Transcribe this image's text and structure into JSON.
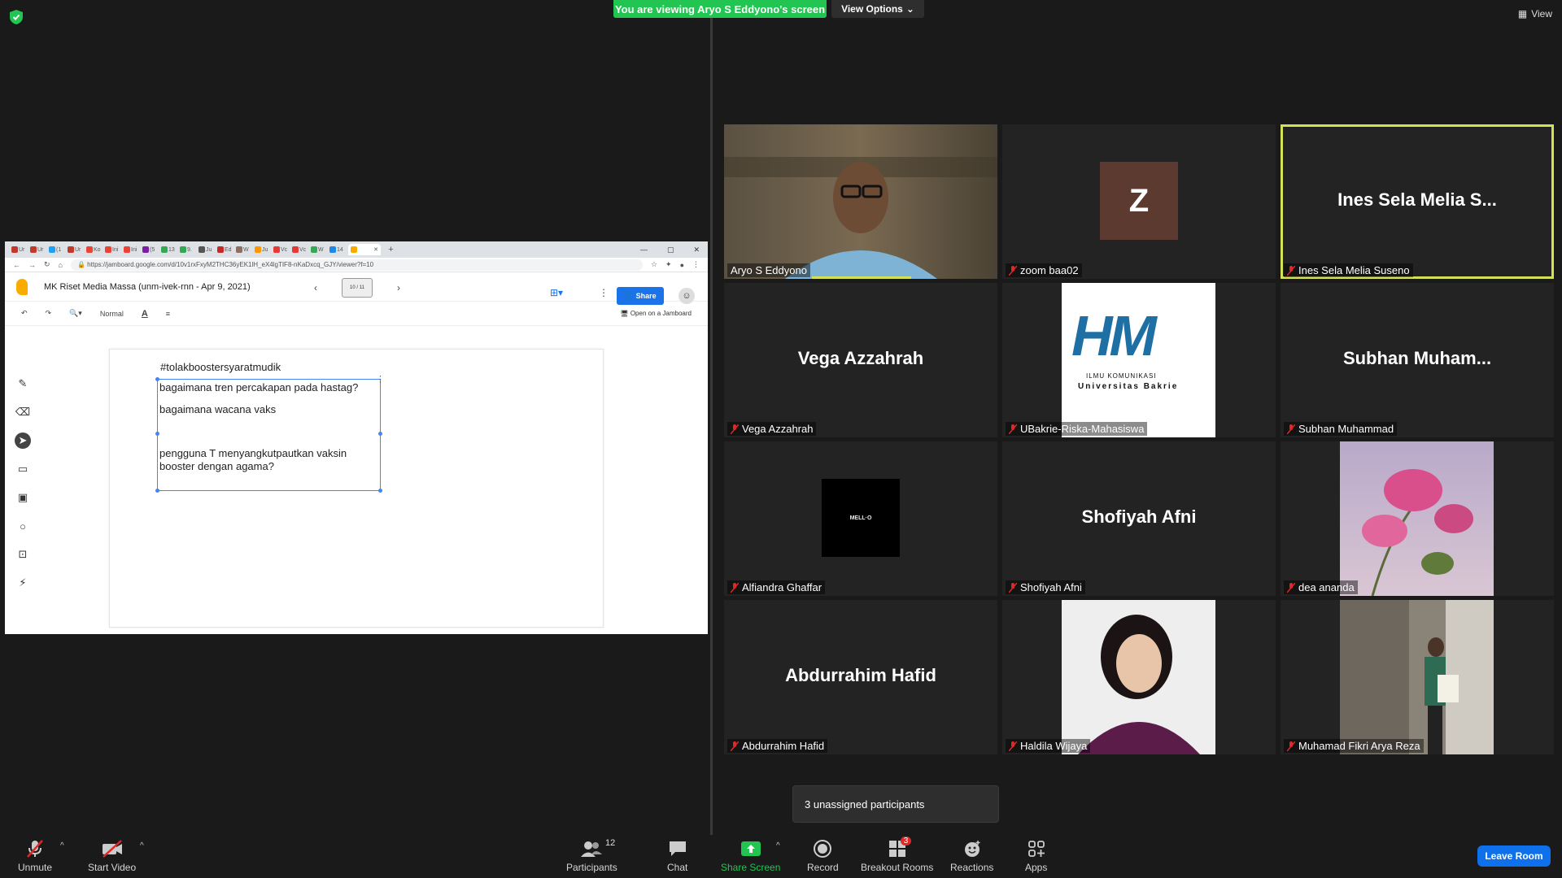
{
  "banner": {
    "viewing": "You are viewing Aryo S Eddyono's screen",
    "view_options": "View Options",
    "view": "View"
  },
  "shared_screen": {
    "tabs": [
      "Ur",
      "Ur",
      "(1",
      "Ur",
      "Ko",
      "Ini",
      "Ini",
      "(5",
      "13",
      "9.",
      "Ju",
      "Ed",
      "W",
      "Ju",
      "Vc",
      "Vc",
      "W",
      "14"
    ],
    "url": "https://jamboard.google.com/d/10v1rxFxyM2THC36yEK1lH_eX4lgTIF8-nKaDxcq_GJY/viewer?f=10",
    "doc_title": "MK Riset Media Massa (unm-ivek-rnn - Apr 9, 2021)",
    "frame_counter": "10 / 11",
    "share_label": "Share",
    "zoom_level": "Normal",
    "open_on_jamboard": "Open on a Jamboard",
    "hashtag": "#tolakboostersyaratmudik",
    "line1": "bagaimana tren percakapan pada hastag?",
    "line2": "bagaimana wacana vaks",
    "line3": "pengguna T menyangkutpautkan vaksin booster dengan agama?"
  },
  "participants": [
    {
      "name": "Aryo S Eddyono",
      "display": "",
      "muted": false
    },
    {
      "name": "zoom baa02",
      "display": "Z",
      "muted": true
    },
    {
      "name": "Ines Sela Melia Suseno",
      "display": "Ines Sela Melia S...",
      "muted": true
    },
    {
      "name": "Vega Azzahrah",
      "display": "Vega Azzahrah",
      "muted": true
    },
    {
      "name": "UBakrie-Riska-Mahasiswa",
      "display": "",
      "muted": true
    },
    {
      "name": "Subhan Muhammad",
      "display": "Subhan  Muham...",
      "muted": true
    },
    {
      "name": "Alfiandra Ghaffar",
      "display": "",
      "muted": true
    },
    {
      "name": "Shofiyah Afni",
      "display": "Shofiyah Afni",
      "muted": true
    },
    {
      "name": "dea ananda",
      "display": "",
      "muted": true
    },
    {
      "name": "Abdurrahim Hafid",
      "display": "Abdurrahim Hafid",
      "muted": true
    },
    {
      "name": "Haldila Wijaya",
      "display": "",
      "muted": true
    },
    {
      "name": "Muhamad Fikri Arya Reza",
      "display": "",
      "muted": true
    }
  ],
  "logo_text": {
    "hm": "HM",
    "ilmu": "ILMU KOMUNIKASI",
    "univ": "Universitas Bakrie",
    "mello": "MELL·O"
  },
  "popup": {
    "unassigned": "3 unassigned participants"
  },
  "toolbar": {
    "unmute": "Unmute",
    "start_video": "Start Video",
    "participants": "Participants",
    "participants_count": "12",
    "chat": "Chat",
    "share_screen": "Share Screen",
    "record": "Record",
    "breakout_rooms": "Breakout Rooms",
    "breakout_badge": "3",
    "reactions": "Reactions",
    "apps": "Apps",
    "leave_room": "Leave Room"
  },
  "colors": {
    "banner_green": "#23c552",
    "active_speaker": "#d4e157",
    "leave_blue": "#0e71eb",
    "share_green": "#23c552",
    "muted_red": "#e02828"
  }
}
